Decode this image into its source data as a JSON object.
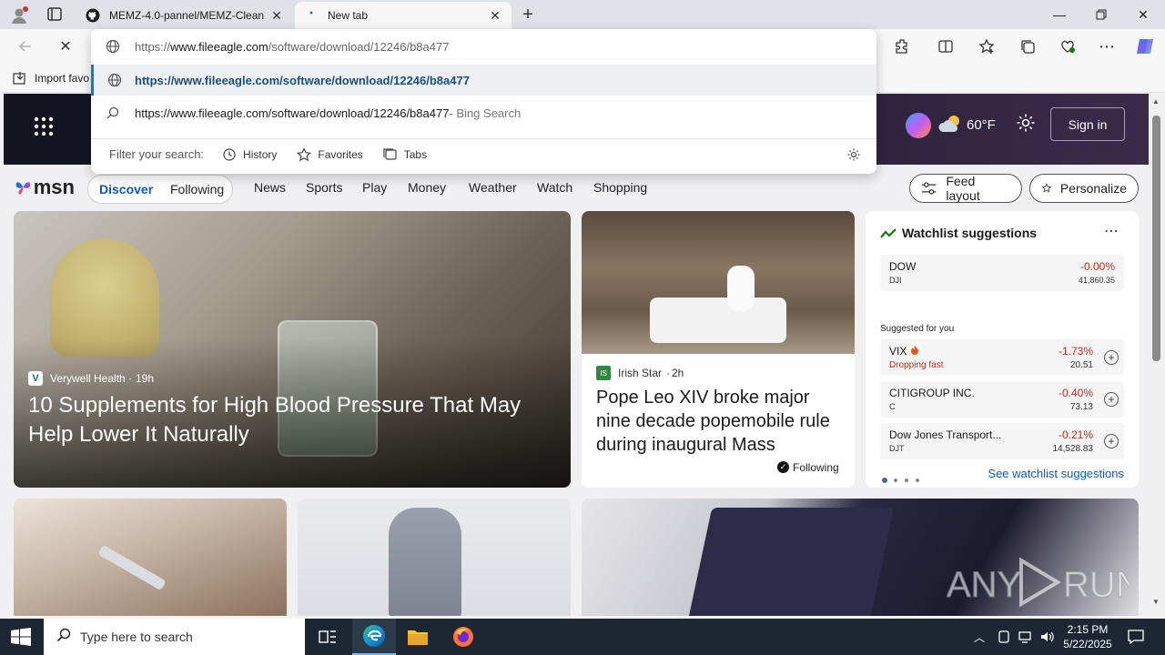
{
  "tabs": [
    {
      "title": "MEMZ-4.0-pannel/MEMZ-Clean",
      "active": false
    },
    {
      "title": "New tab",
      "active": true
    }
  ],
  "omnibox": {
    "input_prefix": "https://",
    "input_domain": "www.fileeagle.com",
    "input_path": "/software/download/12246/b8a477",
    "suggestion_url": "https://www.fileeagle.com/software/download/12246/b8a477",
    "search_query": "https://www.fileeagle.com/software/download/12246/b8a477",
    "search_suffix": " - Bing Search",
    "filter_label": "Filter your search:",
    "filters": [
      "History",
      "Favorites",
      "Tabs"
    ]
  },
  "favorites_bar": {
    "import_label": "Import favo"
  },
  "hero": {
    "temperature": "60°F",
    "sign_in": "Sign in"
  },
  "msn": {
    "logo": "msn",
    "tabs": [
      "Discover",
      "Following"
    ],
    "nav": [
      "News",
      "Sports",
      "Play",
      "Money",
      "Weather",
      "Watch",
      "Shopping"
    ],
    "feed_layout": "Feed layout",
    "personalize": "Personalize"
  },
  "main_story": {
    "source": "Verywell Health",
    "age": "19h",
    "title": "10 Supplements for High Blood Pressure That May Help Lower It Naturally"
  },
  "second_story": {
    "source": "Irish Star",
    "age": "2h",
    "title": "Pope Leo XIV broke major nine decade popemobile rule during inaugural Mass",
    "following": "Following"
  },
  "watchlist": {
    "title": "Watchlist suggestions",
    "suggested_label": "Suggested for you",
    "see_more": "See watchlist suggestions",
    "items": [
      {
        "symbol": "DOW",
        "sub": "DJI",
        "change": "-0.00%",
        "price": "41,860.35",
        "note": ""
      },
      {
        "symbol": "VIX",
        "sub": "Dropping fast",
        "change": "-1.73%",
        "price": "20.51",
        "note": "flame"
      },
      {
        "symbol": "CITIGROUP INC.",
        "sub": "C",
        "change": "-0.40%",
        "price": "73.13",
        "note": ""
      },
      {
        "symbol": "Dow Jones Transport...",
        "sub": "DJT",
        "change": "-0.21%",
        "price": "14,528.83",
        "note": ""
      }
    ],
    "colors": {
      "negative": "#c42b1c",
      "positive": "#0f7b0f"
    }
  },
  "taskbar": {
    "search_placeholder": "Type here to search",
    "time": "2:15 PM",
    "date": "5/22/2025"
  },
  "watermark": "ANY RUN"
}
